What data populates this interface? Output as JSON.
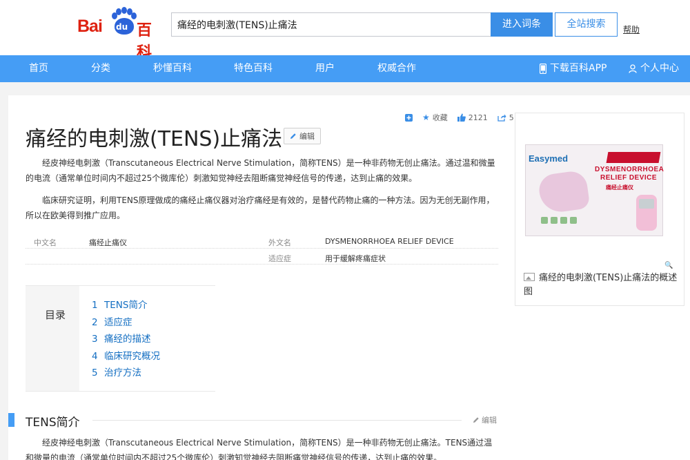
{
  "header": {
    "logo_prefix": "Bai",
    "logo_paw": "du",
    "logo_suffix": "百科",
    "search_value": "痛经的电刺激(TENS)止痛法",
    "enter_button": "进入词条",
    "site_search_button": "全站搜索",
    "help_link": "帮助"
  },
  "nav": {
    "items": [
      "首页",
      "分类",
      "秒懂百科",
      "特色百科",
      "用户",
      "权威合作"
    ],
    "download_app": "下载百科APP",
    "personal_center": "个人中心"
  },
  "toolbar": {
    "add_icon": "plus-square-icon",
    "favorite_label": "收藏",
    "like_count": "2121",
    "share_count": "5"
  },
  "article": {
    "title": "痛经的电刺激(TENS)止痛法",
    "edit_label": "编辑",
    "summary_1": "经皮神经电刺激（Transcutaneous Electrical Nerve Stimulation，简称TENS）是一种非药物无创止痛法。通过温和微量的电流（通常单位时间内不超过25个微库伦）刺激知觉神经去阻断痛觉神经信号的传递，达到止痛的效果。",
    "summary_2": "临床研究证明，利用TENS原理做成的痛经止痛仪器对治疗痛经是有效的，是替代药物止痛的一种方法。因为无创无副作用，所以在欧美得到推广应用。",
    "basic_info": {
      "cn_name_key": "中文名",
      "cn_name_value": "痛经止痛仪",
      "foreign_name_key": "外文名",
      "foreign_name_value": "DYSMENORRHOEA RELIEF DEVICE",
      "indication_key": "适应症",
      "indication_value": "用于缓解疼痛症状"
    },
    "toc": {
      "label": "目录",
      "items": [
        {
          "num": "1",
          "text": "TENS简介"
        },
        {
          "num": "2",
          "text": "适应症"
        },
        {
          "num": "3",
          "text": "痛经的描述"
        },
        {
          "num": "4",
          "text": "临床研究概况"
        },
        {
          "num": "5",
          "text": "治疗方法"
        }
      ]
    },
    "section_1": {
      "title": "TENS简介",
      "edit_label": "编辑",
      "text": "经皮神经电刺激（Transcutaneous Electrical Nerve Stimulation，简称TENS）是一种非药物无创止痛法。TENS通过温和微量的电流（通常单位时间内不超过25个微库伦）刺激知觉神经去阻断痛觉神经信号的传递，达到止痛的效果。"
    }
  },
  "side_card": {
    "box_brand": "Easymed",
    "box_title_line1": "DYSMENORRHOEA",
    "box_title_line2": "RELIEF DEVICE",
    "box_title_cn": "痛经止痛仪",
    "caption": "痛经的电刺激(TENS)止痛法的概述图"
  },
  "colors": {
    "nav_blue": "#459df5",
    "button_blue": "#3a8ee6",
    "link_blue": "#136ec2",
    "logo_red": "#de2110",
    "logo_blue": "#2c63d9"
  }
}
